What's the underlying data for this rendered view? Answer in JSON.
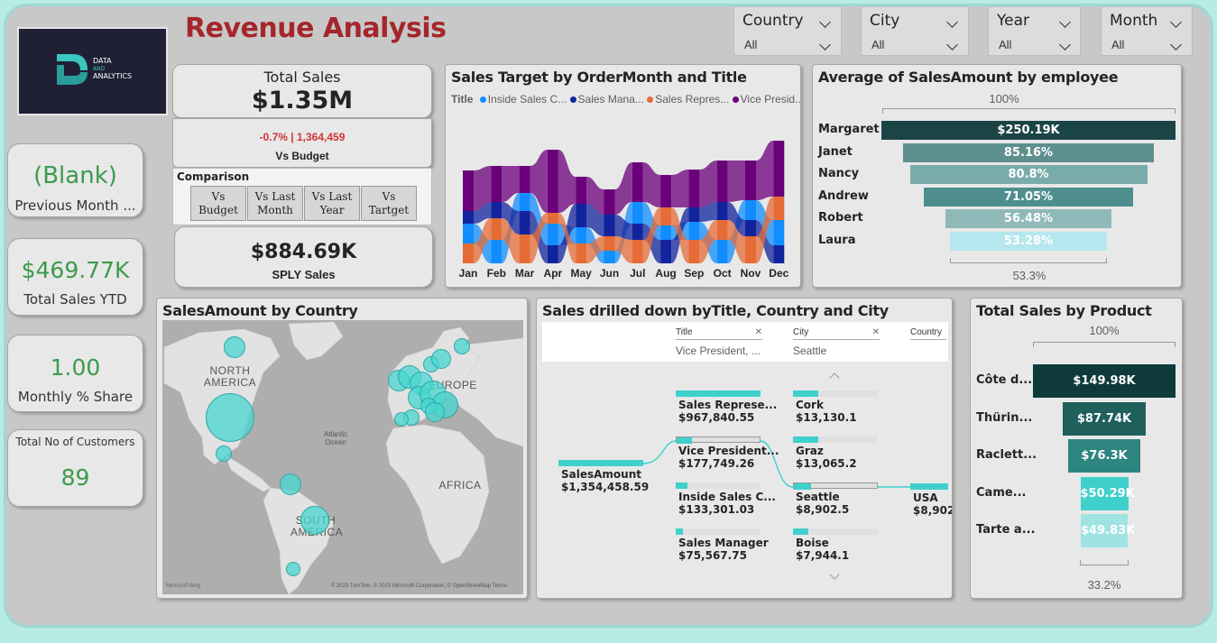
{
  "page": {
    "title": "Revenue Analysis",
    "logo_text_1": "DATA",
    "logo_text_2": "AND",
    "logo_text_3": "ANALYTICS"
  },
  "colors": {
    "title_red": "#a4262c",
    "kpi_green": "#3c9a4c",
    "negative_red": "#d13438",
    "teal_dark": "#1b4446",
    "teal_accent": "#3fd0cc"
  },
  "slicers": [
    {
      "title": "Country",
      "value": "All"
    },
    {
      "title": "City",
      "value": "All"
    },
    {
      "title": "Year",
      "value": "All"
    },
    {
      "title": "Month",
      "value": "All"
    }
  ],
  "kpis": {
    "previous_month": {
      "value": "(Blank)",
      "label": "Previous Month ..."
    },
    "total_sales_ytd": {
      "value": "$469.77K",
      "label": "Total Sales YTD"
    },
    "monthly_share": {
      "value": "1.00",
      "label": "Monthly % Share"
    },
    "total_customers": {
      "value": "89",
      "label": "Total No of Customers"
    }
  },
  "total_sales": {
    "title": "Total Sales",
    "value": "$1.35M",
    "variance": "-0.7% | 1,364,459",
    "variance_label": "Vs Budget",
    "comparison_title": "Comparison",
    "buttons": [
      {
        "line1": "Vs",
        "line2": "Budget"
      },
      {
        "line1": "Vs Last",
        "line2": "Month"
      },
      {
        "line1": "Vs Last",
        "line2": "Year"
      },
      {
        "line1": "Vs",
        "line2": "Tartget"
      }
    ],
    "sply_value": "$884.69K",
    "sply_label": "SPLY Sales"
  },
  "ribbon_chart": {
    "title": "Sales Target by OrderMonth and Title",
    "legend_title": "Title",
    "legend": [
      {
        "name": "Inside Sales C...",
        "color": "#118dff"
      },
      {
        "name": "Sales Mana...",
        "color": "#12239e"
      },
      {
        "name": "Sales Repres...",
        "color": "#e66c37"
      },
      {
        "name": "Vice Presid...",
        "color": "#6b007b"
      }
    ],
    "months": [
      "Jan",
      "Feb",
      "Mar",
      "Apr",
      "May",
      "Jun",
      "Jul",
      "Aug",
      "Sep",
      "Oct",
      "Nov",
      "Dec"
    ]
  },
  "funnel_employee": {
    "title": "Average of SalesAmount by employee",
    "top_pct": "100%",
    "bottom_pct": "53.3%",
    "items": [
      {
        "name": "Margaret",
        "label": "$250.19K",
        "pct": 1.0,
        "color": "#1b4446"
      },
      {
        "name": "Janet",
        "label": "85.16%",
        "pct": 0.8516,
        "color": "#5e8f8f"
      },
      {
        "name": "Nancy",
        "label": "80.8%",
        "pct": 0.808,
        "color": "#7aabab"
      },
      {
        "name": "Andrew",
        "label": "71.05%",
        "pct": 0.7105,
        "color": "#4e8f8e"
      },
      {
        "name": "Robert",
        "label": "56.48%",
        "pct": 0.5648,
        "color": "#8fb9b8"
      },
      {
        "name": "Laura",
        "label": "53.28%",
        "pct": 0.5328,
        "color": "#b5e8ee"
      }
    ]
  },
  "map": {
    "title": "SalesAmount by Country",
    "labels": {
      "north_america": "NORTH AMERICA",
      "europe": "EUROPE",
      "atlantic": "Atlantic Ocean",
      "africa": "AFRICA",
      "south_america": "SOUTH AMERICA"
    },
    "attribution": "© 2023 TomTom, © 2023 Microsoft Corporation, © OpenStreetMap  Terms",
    "bing": "Microsoft Bing"
  },
  "decomp_tree": {
    "title": "Sales drilled down byTitle, Country and City",
    "headers": [
      {
        "label": "Title",
        "value": "Vice President, ..."
      },
      {
        "label": "City",
        "value": "Seattle"
      },
      {
        "label": "Country",
        "value": ""
      }
    ],
    "root": {
      "name": "SalesAmount",
      "value": "$1,354,458.59"
    },
    "titles": [
      {
        "name": "Sales Represe...",
        "value": "$967,840.55",
        "pct": 1.0
      },
      {
        "name": "Vice President...",
        "value": "$177,749.26",
        "pct": 0.18
      },
      {
        "name": "Inside Sales C...",
        "value": "$133,301.03",
        "pct": 0.14
      },
      {
        "name": "Sales Manager",
        "value": "$75,567.75",
        "pct": 0.08
      }
    ],
    "cities": [
      {
        "name": "Cork",
        "value": "$13,130.1",
        "pct": 0.3
      },
      {
        "name": "Graz",
        "value": "$13,065.2",
        "pct": 0.3
      },
      {
        "name": "Seattle",
        "value": "$8,902.5",
        "pct": 0.2
      },
      {
        "name": "Boise",
        "value": "$7,944.1",
        "pct": 0.18
      }
    ],
    "country": {
      "name": "USA",
      "value": "$8,902"
    }
  },
  "funnel_product": {
    "title": "Total Sales by Product",
    "top_pct": "100%",
    "bottom_pct": "33.2%",
    "items": [
      {
        "name": "Côte d...",
        "label": "$149.98K",
        "pct": 1.0,
        "color": "#0e3a3a"
      },
      {
        "name": "Thürin...",
        "label": "$87.74K",
        "pct": 0.585,
        "color": "#1f5f5c"
      },
      {
        "name": "Raclett...",
        "label": "$76.3K",
        "pct": 0.509,
        "color": "#2e8580"
      },
      {
        "name": "Came...",
        "label": "$50.29K",
        "pct": 0.335,
        "color": "#3fd0cc"
      },
      {
        "name": "Tarte a...",
        "label": "$49.83K",
        "pct": 0.332,
        "color": "#9fe4e2"
      }
    ]
  }
}
